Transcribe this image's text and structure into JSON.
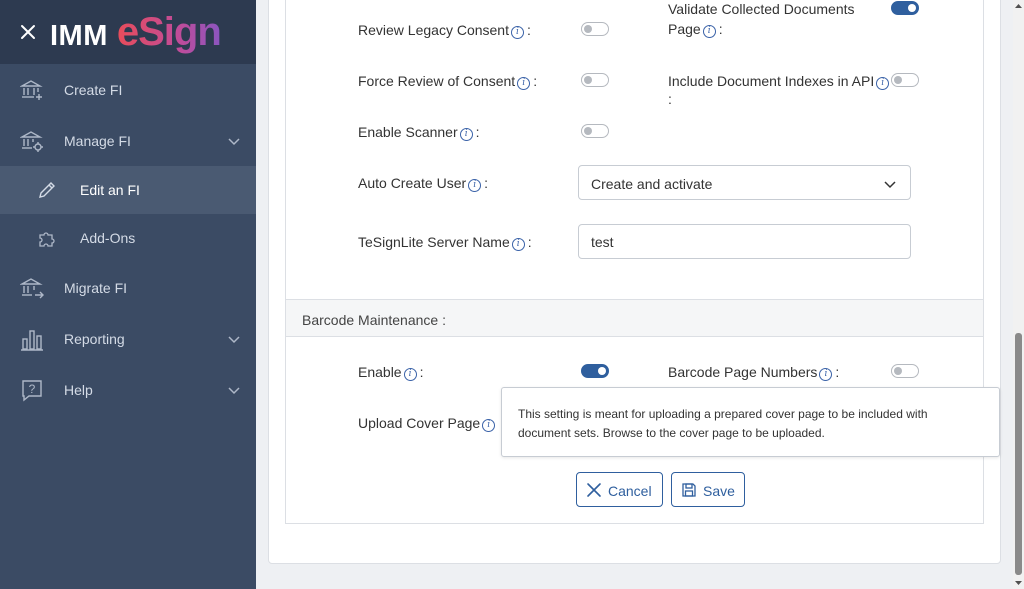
{
  "sidebar": {
    "logo_left": "IMM",
    "logo_right": "eSign",
    "items": [
      {
        "label": "Create FI"
      },
      {
        "label": "Manage FI"
      },
      {
        "label": "Edit an FI"
      },
      {
        "label": "Add-Ons"
      },
      {
        "label": "Migrate FI"
      },
      {
        "label": "Reporting"
      },
      {
        "label": "Help"
      }
    ]
  },
  "form": {
    "review_legacy_consent": {
      "label": "Review Legacy Consent",
      "enabled": false
    },
    "validate_collected_documents": {
      "label_line1": "Validate Collected Documents",
      "label_line2": "Page",
      "enabled": true
    },
    "force_review_consent": {
      "label": "Force Review of Consent",
      "enabled": false
    },
    "include_document_indexes": {
      "label": "Include Document Indexes in API",
      "enabled": false
    },
    "enable_scanner": {
      "label": "Enable Scanner",
      "enabled": false
    },
    "auto_create_user": {
      "label": "Auto Create User",
      "value": "Create and activate"
    },
    "tesignlite_server_name": {
      "label": "TeSignLite Server Name",
      "value": "test"
    }
  },
  "barcode": {
    "section_title": "Barcode Maintenance :",
    "enable": {
      "label": "Enable",
      "enabled": true
    },
    "barcode_page_numbers": {
      "label": "Barcode Page Numbers",
      "enabled": false
    },
    "upload_cover_page": {
      "label": "Upload Cover Page"
    }
  },
  "tooltip": {
    "text": "This setting is meant for uploading a prepared cover page to be included with document sets. Browse to the cover page to be uploaded."
  },
  "buttons": {
    "cancel": "Cancel",
    "save": "Save"
  },
  "colors": {
    "sidebar_bg": "#3b4b64",
    "sidebar_header": "#2d3a50",
    "accent": "#2f5f9e"
  },
  "icon_glyphs": {
    "info": "i",
    "colon": ":"
  }
}
